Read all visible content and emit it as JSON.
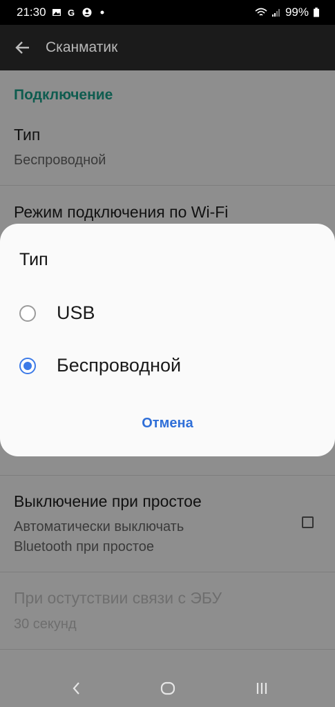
{
  "status_bar": {
    "time": "21:30",
    "left_icons": [
      "image-icon",
      "google-g-icon",
      "account-icon",
      "dot-icon"
    ],
    "battery": "99%"
  },
  "app_bar": {
    "title": "Сканматик"
  },
  "settings": {
    "section_header": "Подключение",
    "type_title": "Тип",
    "type_value": "Беспроводной",
    "wifi_mode_title": "Режим подключения по Wi-Fi",
    "idle_title": "Выключение при простое",
    "idle_sub_line1": "Автоматически выключать",
    "idle_sub_line2": "Bluetooth при простое",
    "no_link_title": "При остутствии связи с ЭБУ",
    "no_link_value": "30 секунд"
  },
  "dialog": {
    "title": "Тип",
    "options": [
      {
        "label": "USB",
        "selected": false
      },
      {
        "label": "Беспроводной",
        "selected": true
      }
    ],
    "cancel_label": "Отмена"
  },
  "colors": {
    "accent": "#3c7ae7",
    "section_header": "#0e5c4f",
    "cancel": "#2f6fd8"
  }
}
